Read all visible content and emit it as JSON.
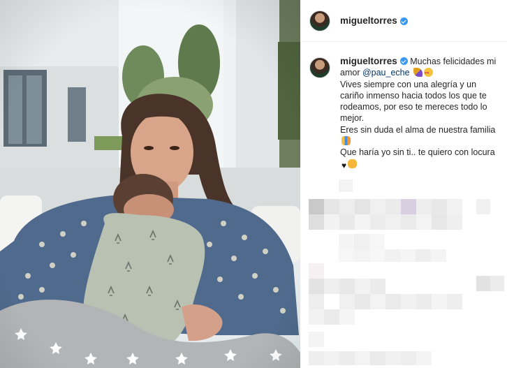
{
  "post": {
    "author": {
      "username": "migueltorres",
      "verified": true,
      "verified_color": "#3897f0",
      "avatar_icon": "avatar"
    },
    "caption": {
      "username": "migueltorres",
      "line1": "Muchas felicidades mi amor",
      "mention": "@pau_eche",
      "emoji_1": "party-popper-icon",
      "emoji_2": "heart-eyes-icon",
      "line2": "Vives siempre con una alegría y un cariño inmenso hacia todos los que te rodeamos, por eso te mereces todo lo mejor.",
      "line3": "Eres sin duda el alma de nuestra familia",
      "emoji_3": "family-icon",
      "line4": "Que haría yo sin ti.. te quiero con locura",
      "emoji_4": "black-heart-icon",
      "emoji_5": "hug-icon"
    },
    "comments_obscured": true
  },
  "photo": {
    "description_icon": "photo-mother-and-baby"
  },
  "colors": {
    "mention": "#00376b",
    "text": "#262626",
    "divider": "#efefef"
  }
}
